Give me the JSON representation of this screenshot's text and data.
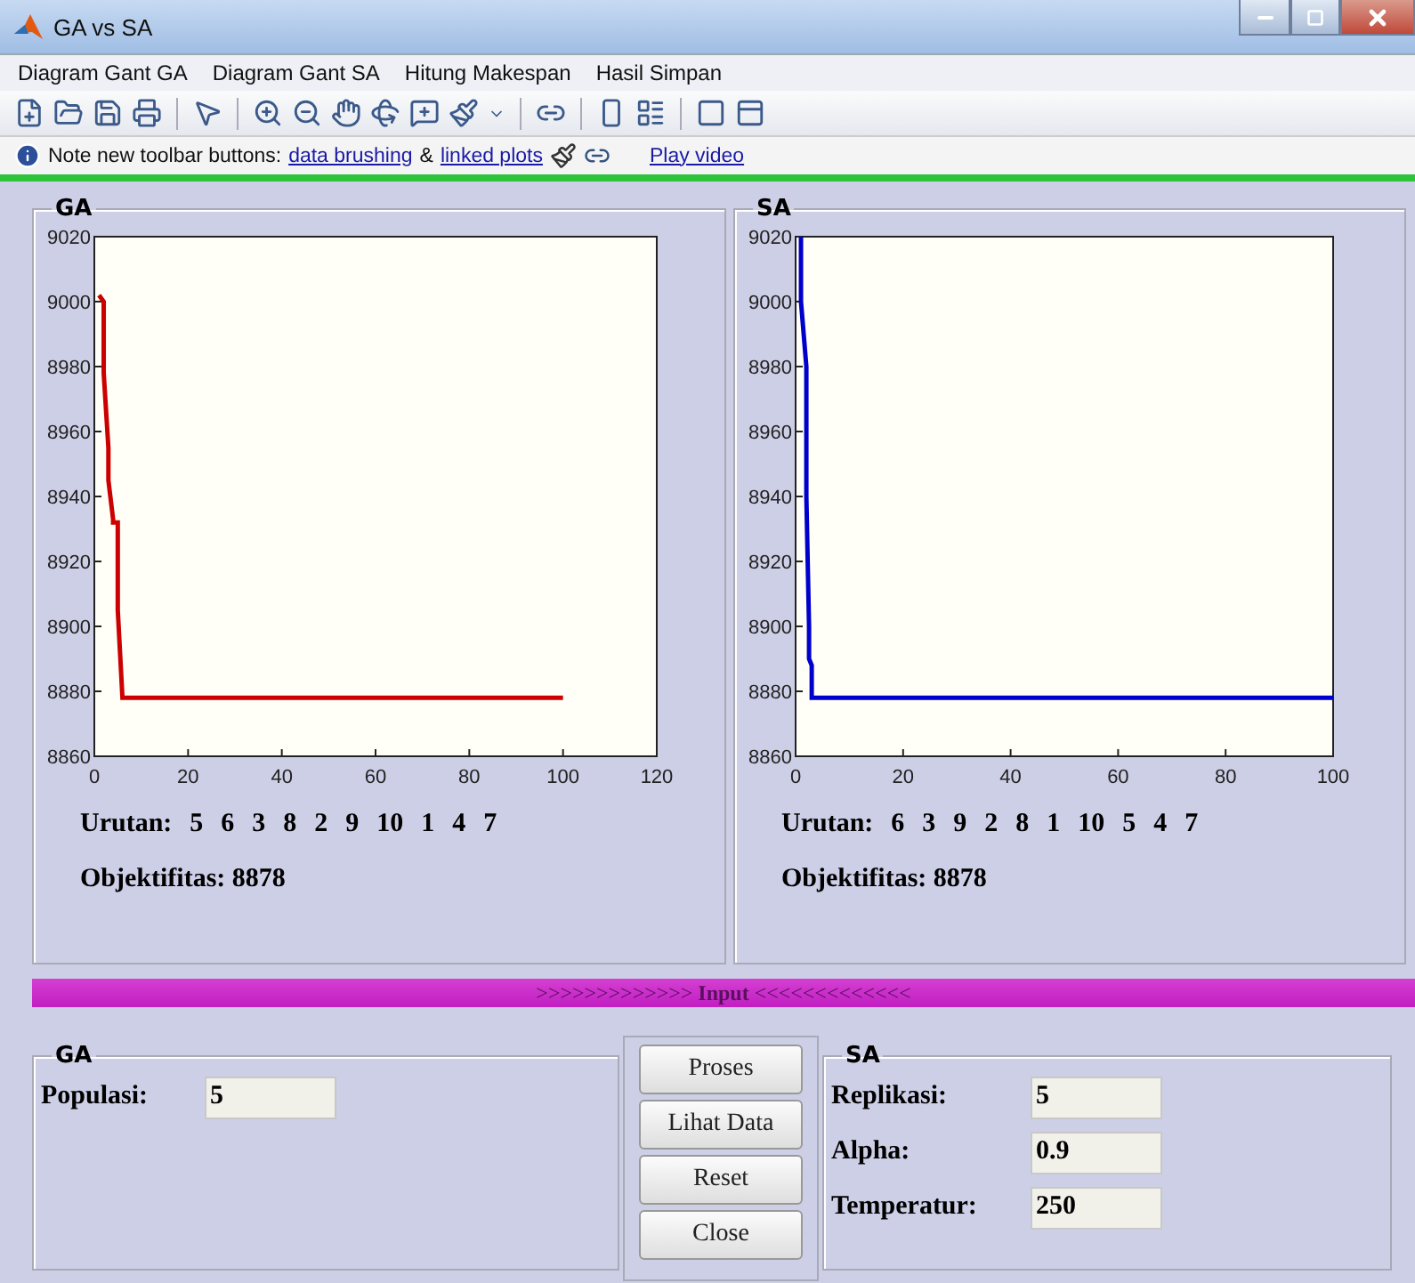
{
  "window": {
    "title": "GA vs SA"
  },
  "menu": [
    "Diagram Gant GA",
    "Diagram Gant SA",
    "Hitung Makespan",
    "Hasil Simpan"
  ],
  "info_bar": [
    {
      "kind": "text",
      "text": "Note new toolbar buttons:"
    },
    {
      "kind": "link",
      "text": "data brushing"
    },
    {
      "kind": "text",
      "text": "&"
    },
    {
      "kind": "link",
      "text": "linked plots"
    },
    {
      "kind": "icons"
    },
    {
      "kind": "link",
      "text": "Play video"
    }
  ],
  "results": [
    {
      "title": "GA",
      "chart_data": {
        "type": "line",
        "x": [
          1,
          2,
          2,
          3,
          3,
          4,
          4,
          5,
          5,
          6,
          100
        ],
        "series": [
          {
            "color": "#cc0000",
            "values": [
              9002,
              9000,
              8978,
              8955,
              8945,
              8933,
              8932,
              8932,
              8905,
              8878,
              8878
            ]
          }
        ],
        "xlim": [
          0,
          120
        ],
        "ylim": [
          8860,
          9020
        ],
        "xticks": [
          0,
          20,
          40,
          60,
          80,
          100,
          120
        ],
        "yticks": [
          8860,
          8880,
          8900,
          8920,
          8940,
          8960,
          8980,
          9000,
          9020
        ]
      },
      "order_label": "Urutan:",
      "order": [
        "5",
        "6",
        "3",
        "8",
        "2",
        "9",
        "10",
        "1",
        "4",
        "7"
      ],
      "objective": "Objektifitas: 8878"
    },
    {
      "title": "SA",
      "chart_data": {
        "type": "line",
        "x": [
          1,
          1,
          2,
          2,
          2.5,
          2.5,
          3,
          3,
          100
        ],
        "series": [
          {
            "color": "#0000cc",
            "values": [
              9020,
              9000,
              8980,
              8940,
              8900,
              8890,
              8888,
              8878,
              8878
            ]
          }
        ],
        "xlim": [
          0,
          100
        ],
        "ylim": [
          8860,
          9020
        ],
        "xticks": [
          0,
          20,
          40,
          60,
          80,
          100
        ],
        "yticks": [
          8860,
          8880,
          8900,
          8920,
          8940,
          8960,
          8980,
          9000,
          9020
        ]
      },
      "order_label": "Urutan:",
      "order": [
        "6",
        "3",
        "9",
        "2",
        "8",
        "1",
        "10",
        "5",
        "4",
        "7"
      ],
      "objective": "Objektifitas: 8878"
    }
  ],
  "input_banner": ">>>>>>>>>>>>> **Input** <<<<<<<<<<<<<",
  "ga_input": {
    "title": "GA",
    "fields": [
      {
        "label": "Populasi:",
        "value": "5"
      }
    ]
  },
  "buttons": [
    "Proses",
    "Lihat Data",
    "Reset",
    "Close"
  ],
  "sa_input": {
    "title": "SA",
    "fields": [
      {
        "label": "Replikasi:",
        "value": "5"
      },
      {
        "label": "Alpha:",
        "value": "0.9"
      },
      {
        "label": "Temperatur:",
        "value": "250"
      }
    ]
  }
}
